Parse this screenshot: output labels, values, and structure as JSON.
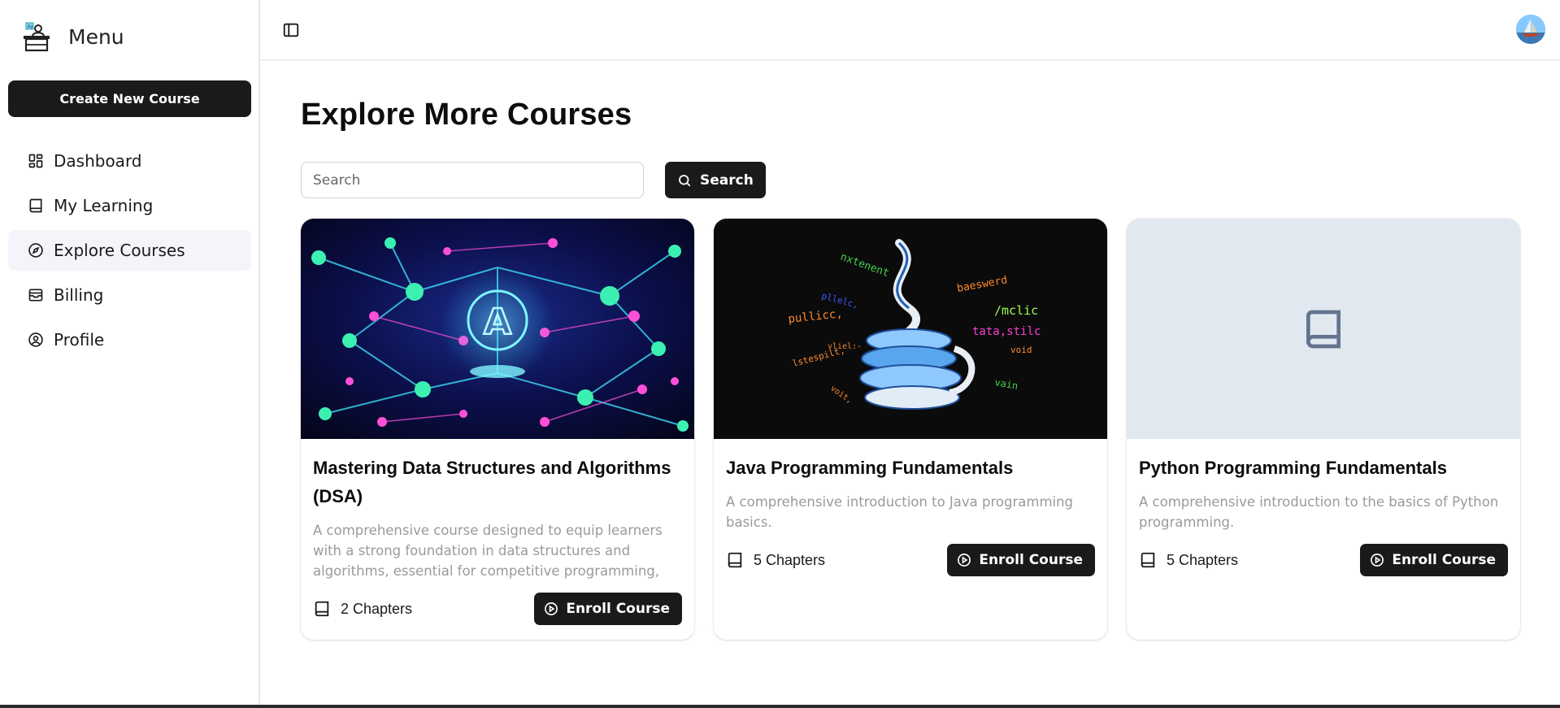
{
  "sidebar": {
    "title": "Menu",
    "create_button": "Create New Course",
    "items": [
      {
        "label": "Dashboard",
        "icon": "dashboard-icon",
        "active": false
      },
      {
        "label": "My Learning",
        "icon": "book-icon",
        "active": false
      },
      {
        "label": "Explore Courses",
        "icon": "compass-icon",
        "active": true
      },
      {
        "label": "Billing",
        "icon": "wallet-icon",
        "active": false
      },
      {
        "label": "Profile",
        "icon": "user-circle-icon",
        "active": false
      }
    ]
  },
  "main": {
    "title": "Explore More Courses",
    "search": {
      "placeholder": "Search",
      "value": "",
      "button_label": "Search"
    },
    "courses": [
      {
        "title": "Mastering Data Structures and Algorithms (DSA)",
        "description": "A comprehensive course designed to equip learners with a strong foundation in data structures and algorithms, essential for competitive programming, technical...",
        "chapters": "2 Chapters",
        "button": "Enroll Course",
        "image": "ai-network-illustration"
      },
      {
        "title": "Java Programming Fundamentals",
        "description": "A comprehensive introduction to Java programming basics.",
        "chapters": "5 Chapters",
        "button": "Enroll Course",
        "image": "java-logo-illustration",
        "image_words": [
          "nxtenent",
          "baeswerd",
          "pllelc,",
          "/mclic",
          "pullicc,",
          "tata,stilc",
          "vliel:-",
          "void",
          "lstespilt,",
          "voit,",
          "vain"
        ]
      },
      {
        "title": "Python Programming Fundamentals",
        "description": "A comprehensive introduction to the basics of Python programming.",
        "chapters": "5 Chapters",
        "button": "Enroll Course",
        "image": "placeholder-book-icon"
      }
    ]
  },
  "colors": {
    "primary_button": "#1a1a1a",
    "active_nav_bg": "#f7f3fb",
    "placeholder_bg": "#e2e8f0",
    "muted_text": "#9a9a9a"
  }
}
